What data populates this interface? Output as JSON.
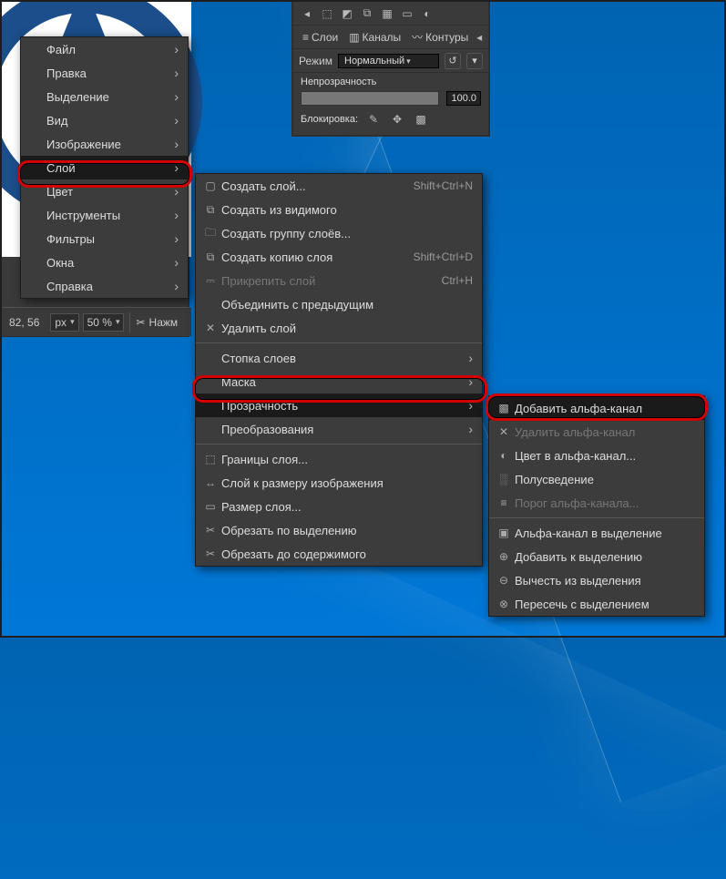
{
  "status": {
    "coords": "82, 56",
    "unit": "px",
    "zoom": "50 %",
    "tool_label": "Нажм"
  },
  "dock": {
    "tabs": {
      "layers": "Слои",
      "channels": "Каналы",
      "paths": "Контуры"
    },
    "mode_label": "Режим",
    "mode_value": "Нормальный",
    "opacity_label": "Непрозрачность",
    "opacity_value": "100.0",
    "lock_label": "Блокировка:"
  },
  "menu1": {
    "items": [
      {
        "label": "Файл"
      },
      {
        "label": "Правка"
      },
      {
        "label": "Выделение"
      },
      {
        "label": "Вид"
      },
      {
        "label": "Изображение"
      },
      {
        "label": "Слой"
      },
      {
        "label": "Цвет"
      },
      {
        "label": "Инструменты"
      },
      {
        "label": "Фильтры"
      },
      {
        "label": "Окна"
      },
      {
        "label": "Справка"
      }
    ]
  },
  "menu2": {
    "group1": [
      {
        "icon": "▢",
        "label": "Создать слой...",
        "accel": "Shift+Ctrl+N"
      },
      {
        "icon": "⧉",
        "label": "Создать из видимого",
        "accel": ""
      },
      {
        "icon": "🗀",
        "label": "Создать группу слоёв...",
        "accel": ""
      },
      {
        "icon": "⧉",
        "label": "Создать копию слоя",
        "accel": "Shift+Ctrl+D"
      },
      {
        "icon": "⎓",
        "label": "Прикрепить слой",
        "accel": "Ctrl+H"
      },
      {
        "icon": "",
        "label": "Объединить с предыдущим",
        "accel": ""
      },
      {
        "icon": "✕",
        "label": "Удалить слой",
        "accel": ""
      }
    ],
    "group2": [
      {
        "label": "Стопка слоев"
      },
      {
        "label": "Маска"
      },
      {
        "label": "Прозрачность"
      },
      {
        "label": "Преобразования"
      }
    ],
    "group3": [
      {
        "icon": "⬚",
        "label": "Границы слоя..."
      },
      {
        "icon": "↔",
        "label": "Слой к размеру изображения"
      },
      {
        "icon": "▭",
        "label": "Размер слоя..."
      },
      {
        "icon": "✂",
        "label": "Обрезать по выделению"
      },
      {
        "icon": "✂",
        "label": "Обрезать до содержимого"
      }
    ]
  },
  "menu3": {
    "group1": [
      {
        "icon": "▩",
        "label": "Добавить альфа-канал",
        "disabled": false
      },
      {
        "icon": "✕",
        "label": "Удалить альфа-канал",
        "disabled": true
      },
      {
        "icon": "◐",
        "label": "Цвет в альфа-канал...",
        "disabled": false
      },
      {
        "icon": "░",
        "label": "Полусведение",
        "disabled": false
      },
      {
        "icon": "≡",
        "label": "Порог альфа-канала...",
        "disabled": true
      }
    ],
    "group2": [
      {
        "icon": "▣",
        "label": "Альфа-канал в выделение"
      },
      {
        "icon": "⊕",
        "label": "Добавить к выделению"
      },
      {
        "icon": "⊖",
        "label": "Вычесть из выделения"
      },
      {
        "icon": "⊗",
        "label": "Пересечь с выделением"
      }
    ]
  },
  "icons": {
    "scissors": "✂"
  }
}
